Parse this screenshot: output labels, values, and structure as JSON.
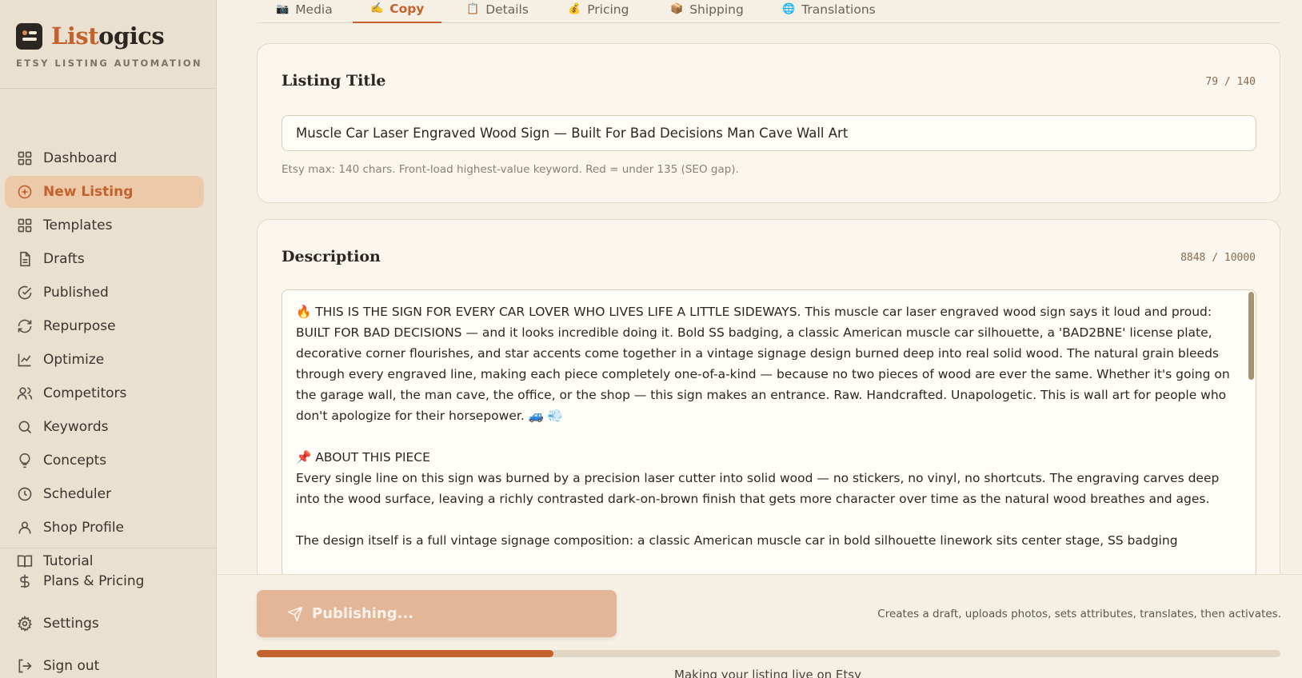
{
  "brand": {
    "name_part1": "List",
    "name_part2": "ogics",
    "subtitle": "ETSY LISTING AUTOMATION"
  },
  "sidebar": {
    "items": [
      {
        "label": "Dashboard",
        "icon": "grid-icon"
      },
      {
        "label": "New Listing",
        "icon": "plus-circle-icon",
        "active": true
      },
      {
        "label": "Templates",
        "icon": "grid-icon"
      },
      {
        "label": "Drafts",
        "icon": "file-icon"
      },
      {
        "label": "Published",
        "icon": "check-circle-icon"
      },
      {
        "label": "Repurpose",
        "icon": "refresh-icon"
      },
      {
        "label": "Optimize",
        "icon": "chart-line-icon"
      },
      {
        "label": "Competitors",
        "icon": "users-icon"
      },
      {
        "label": "Keywords",
        "icon": "search-icon"
      },
      {
        "label": "Concepts",
        "icon": "lightbulb-icon"
      },
      {
        "label": "Scheduler",
        "icon": "clock-icon"
      },
      {
        "label": "Shop Profile",
        "icon": "user-icon"
      },
      {
        "label": "Tutorial",
        "icon": "book-icon"
      }
    ],
    "bottom": [
      {
        "label": "Plans & Pricing",
        "icon": "dollar-icon"
      },
      {
        "label": "Settings",
        "icon": "gear-icon"
      },
      {
        "label": "Sign out",
        "icon": "sign-out-icon"
      }
    ]
  },
  "tabs": [
    {
      "label": "Media",
      "icon": "📷"
    },
    {
      "label": "Copy",
      "icon": "✍️",
      "active": true
    },
    {
      "label": "Details",
      "icon": "📋"
    },
    {
      "label": "Pricing",
      "icon": "💰"
    },
    {
      "label": "Shipping",
      "icon": "📦"
    },
    {
      "label": "Translations",
      "icon": "🌐"
    }
  ],
  "title_card": {
    "heading": "Listing Title",
    "counter": "79 / 140",
    "value": "Muscle Car Laser Engraved Wood Sign — Built For Bad Decisions Man Cave Wall Art",
    "hint": "Etsy max: 140 chars. Front-load highest-value keyword. Red = under 135 (SEO gap)."
  },
  "description_card": {
    "heading": "Description",
    "counter": "8848 / 10000",
    "text": "🔥 THIS IS THE SIGN FOR EVERY CAR LOVER WHO LIVES LIFE A LITTLE SIDEWAYS. This muscle car laser engraved wood sign says it loud and proud: BUILT FOR BAD DECISIONS — and it looks incredible doing it. Bold SS badging, a classic American muscle car silhouette, a 'BAD2BNE' license plate, decorative corner flourishes, and star accents come together in a vintage signage design burned deep into real solid wood. The natural grain bleeds through every engraved line, making each piece completely one-of-a-kind — because no two pieces of wood are ever the same. Whether it's going on the garage wall, the man cave, the office, or the shop — this sign makes an entrance. Raw. Handcrafted. Unapologetic. This is wall art for people who don't apologize for their horsepower. 🚙 💨\n\n📌 ABOUT THIS PIECE\nEvery single line on this sign was burned by a precision laser cutter into solid wood — no stickers, no vinyl, no shortcuts. The engraving carves deep into the wood surface, leaving a richly contrasted dark-on-brown finish that gets more character over time as the natural wood breathes and ages.\n\nThe design itself is a full vintage signage composition: a classic American muscle car in bold silhouette linework sits center stage, SS badging"
  },
  "publish": {
    "button_label": "Publishing...",
    "note": "Creates a draft, uploads photos, sets attributes, translates, then activates.",
    "progress": 0.29,
    "status": "Making your listing live on Etsy"
  },
  "colors": {
    "accent": "#c4622d",
    "background": "#f5efe4",
    "sidebar": "#e9e0d0"
  }
}
